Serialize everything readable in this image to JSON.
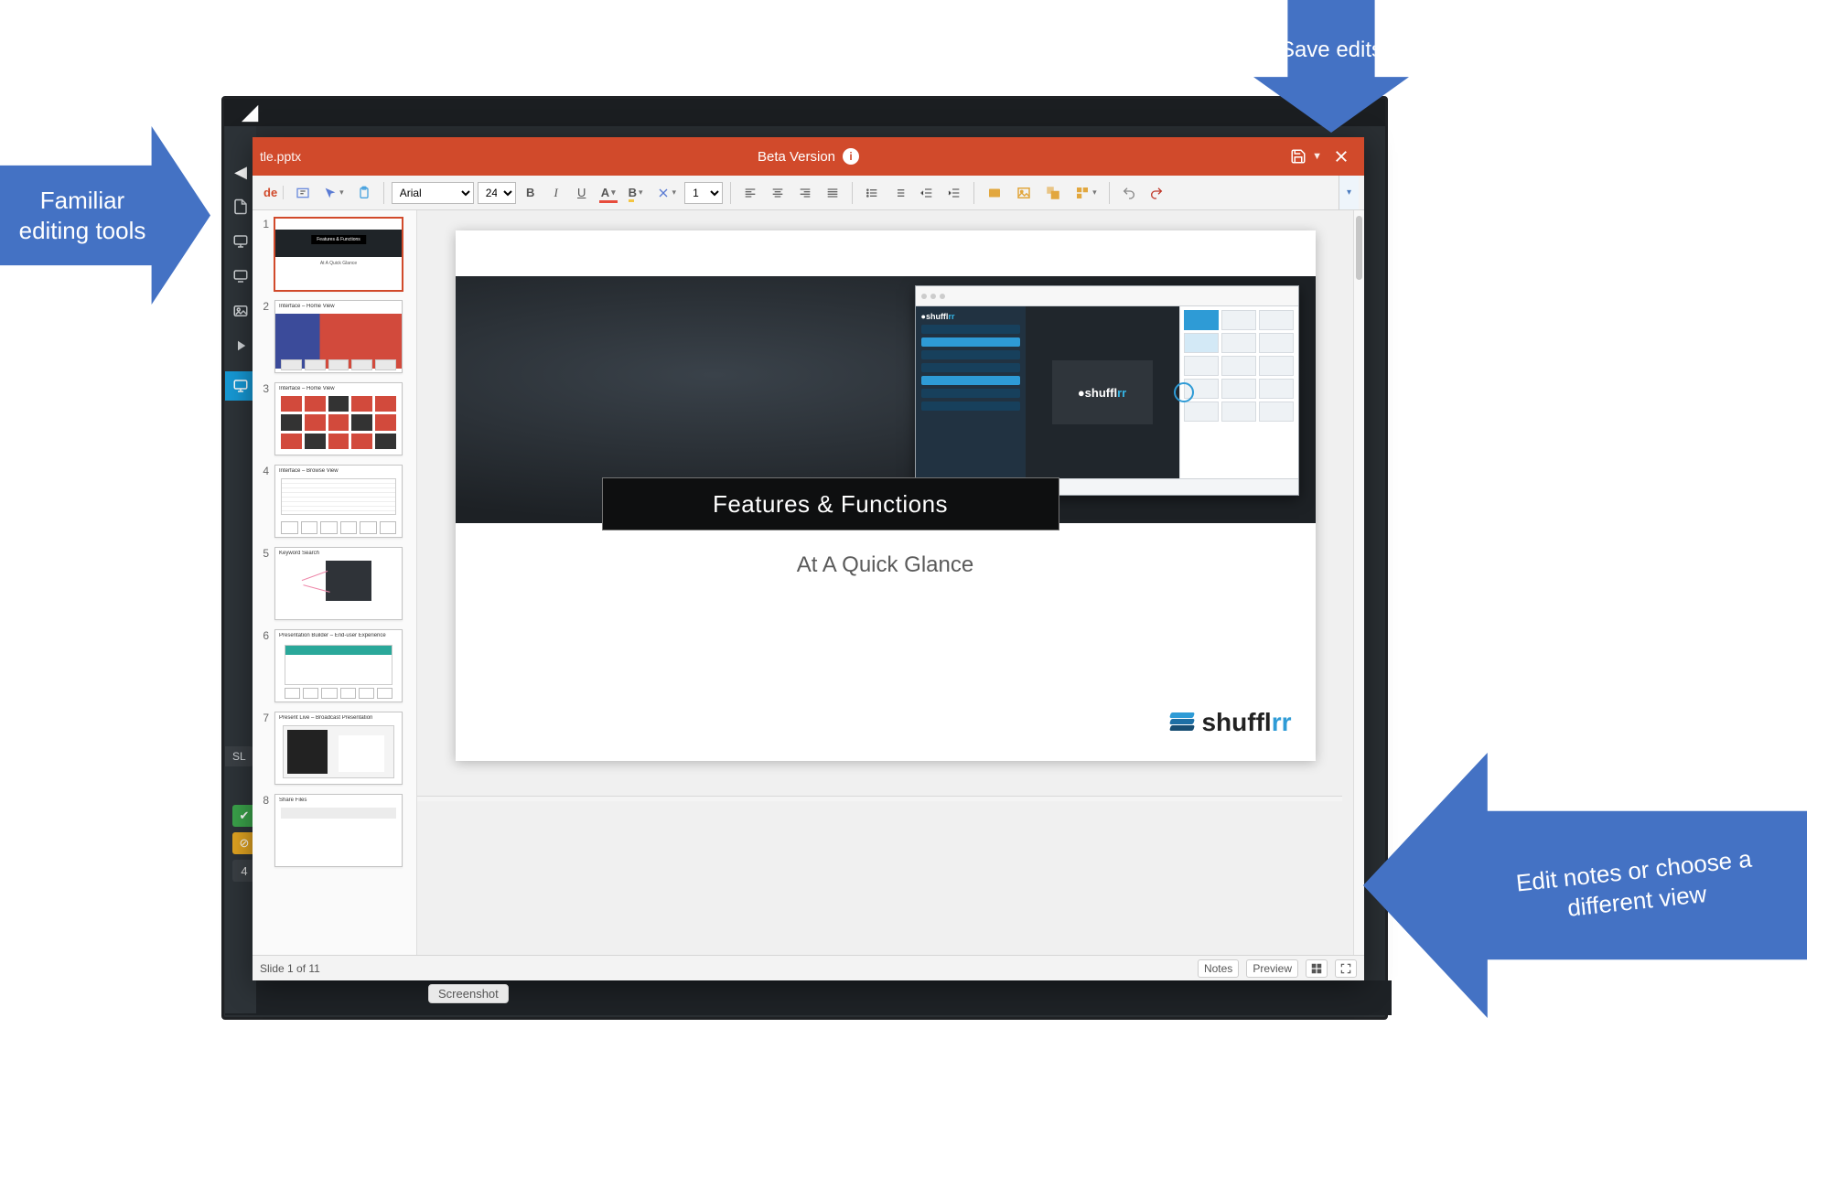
{
  "callouts": {
    "left": "Familiar editing tools",
    "top": "Save edits",
    "right": "Edit notes or choose a different view"
  },
  "titlebar": {
    "doc_name": "tle.pptx",
    "center_label": "Beta Version",
    "info_icon": "info-icon",
    "save_label": "Save",
    "close_label": "Close"
  },
  "toolbar": {
    "mode": "de",
    "font_name": "Arial",
    "font_size": "24",
    "line_spacing": "1",
    "bold": "B",
    "italic": "I",
    "underline": "U",
    "font_color_letter": "A",
    "highlight_letter": "B"
  },
  "thumbs": {
    "items": [
      {
        "n": "1",
        "title": "Features & Functions",
        "subtitle": "At A Quick Glance",
        "selected": true
      },
      {
        "n": "2",
        "title": "Interface – Home View"
      },
      {
        "n": "3",
        "title": "Interface – Home View"
      },
      {
        "n": "4",
        "title": "Interface – Browse View"
      },
      {
        "n": "5",
        "title": "Keyword Search"
      },
      {
        "n": "6",
        "title": "Presentation Builder – End-user Experience"
      },
      {
        "n": "7",
        "title": "Present Live – Broadcast Presentation"
      },
      {
        "n": "8",
        "title": "Share Files"
      }
    ]
  },
  "slide": {
    "heading": "Features & Functions",
    "subheading": "At A Quick Glance",
    "brand_name": "shuffl",
    "brand_suffix": "rr",
    "embedded_brand": "shuffl",
    "embedded_brand_suffix": "rr"
  },
  "statusbar": {
    "position": "Slide 1 of 11",
    "notes": "Notes",
    "preview": "Preview",
    "grid_view": "Grid view",
    "fit_view": "Fit"
  },
  "misc": {
    "screenshot_tag": "Screenshot",
    "bg_slides_label": "SL",
    "bg_count": "4"
  },
  "colors": {
    "accent_orange": "#D14A2B",
    "callout_blue": "#4472C4",
    "brand_blue": "#2e9bd6"
  }
}
